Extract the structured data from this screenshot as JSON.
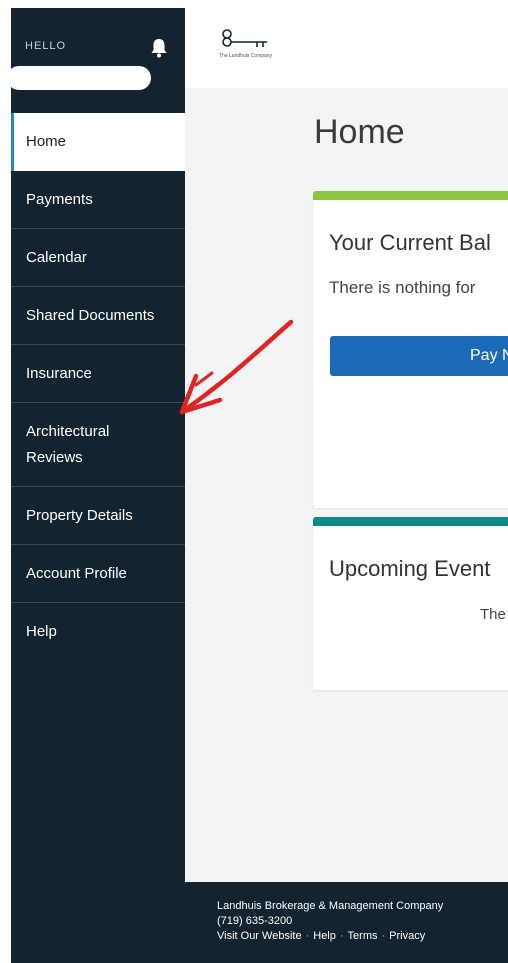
{
  "sidebar": {
    "hello_label": "HELLO",
    "items": [
      {
        "label": "Home"
      },
      {
        "label": "Payments"
      },
      {
        "label": "Calendar"
      },
      {
        "label": "Shared Documents"
      },
      {
        "label": "Insurance"
      },
      {
        "label": "Architectural",
        "label2": "Reviews"
      },
      {
        "label": "Property Details"
      },
      {
        "label": "Account Profile"
      },
      {
        "label": "Help"
      }
    ]
  },
  "header": {
    "logo_text": "The Landhuis Company"
  },
  "main": {
    "title": "Home",
    "balance_card": {
      "title": "Your Current Bal",
      "text": "There is nothing for",
      "button_label": "Pay N"
    },
    "events_card": {
      "title": "Upcoming Event",
      "text": "The"
    }
  },
  "footer": {
    "company": "Landhuis Brokerage & Management Company",
    "phone": "(719) 635-3200",
    "links": [
      "Visit Our Website",
      "Help",
      "Terms",
      "Privacy"
    ]
  },
  "colors": {
    "sidebar_bg": "#13232f",
    "active_accent": "#2e86c1",
    "balance_accent": "#8dc63f",
    "events_accent": "#0f8a87",
    "button_blue": "#1b6ab8",
    "annotation_arrow": "#e02424"
  }
}
